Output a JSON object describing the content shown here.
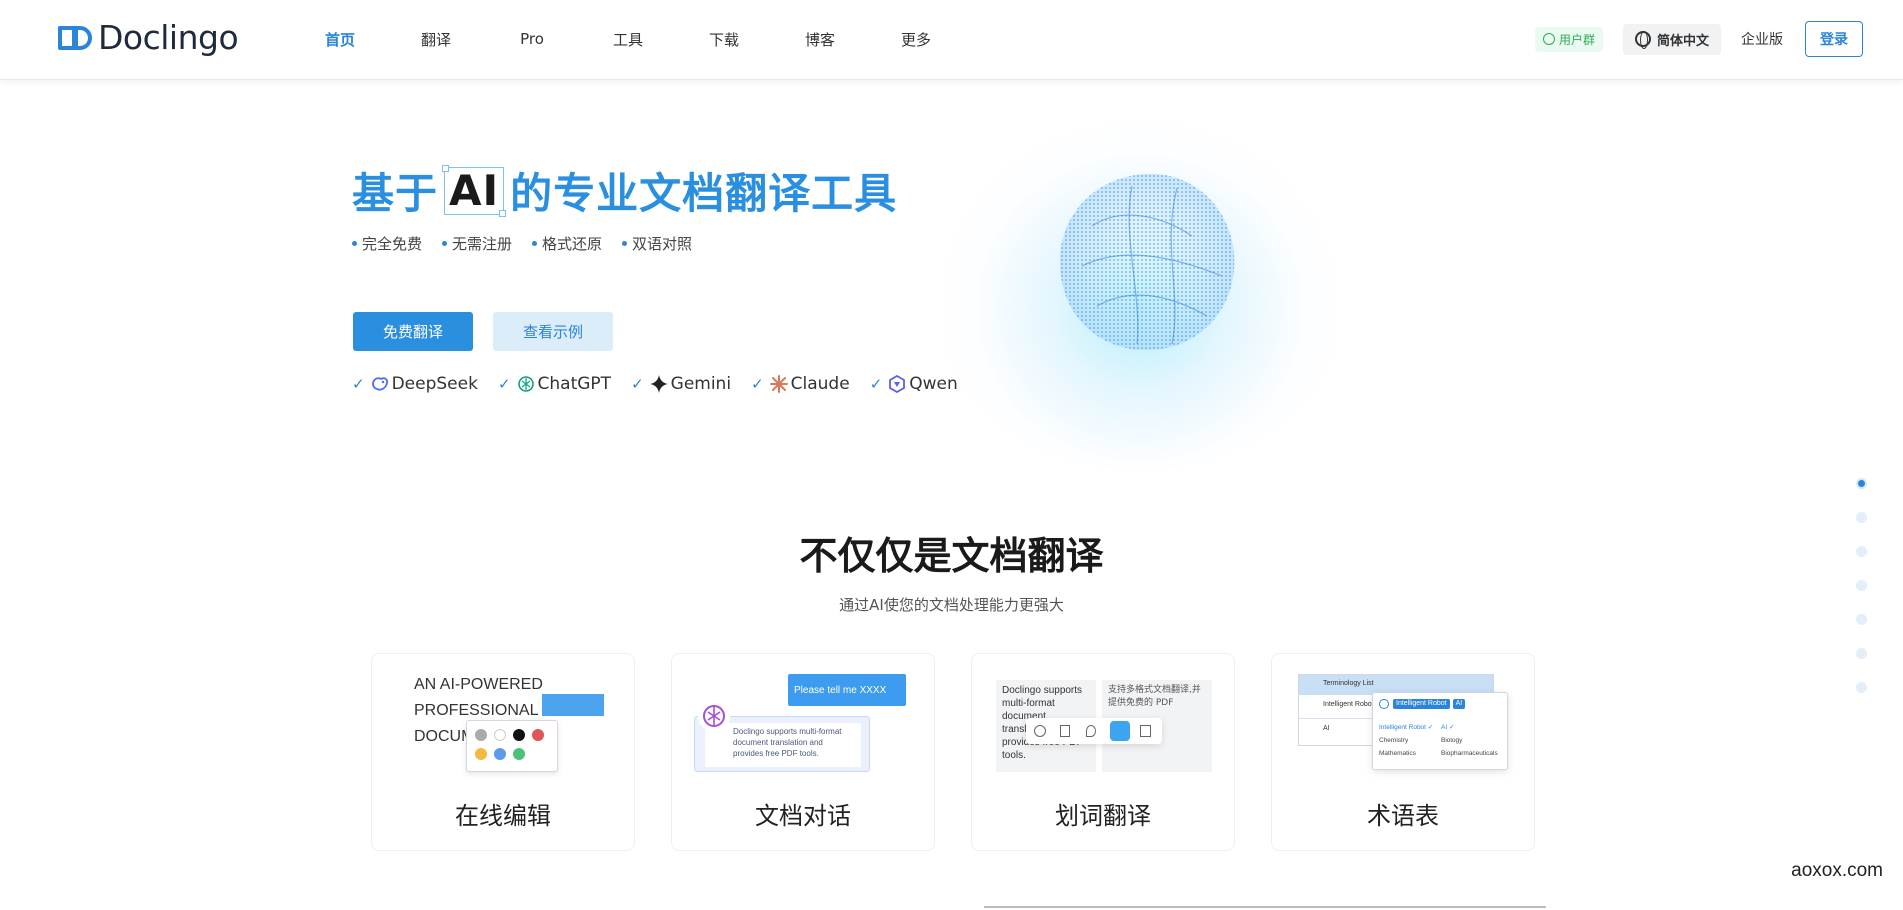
{
  "header": {
    "logo_text": "Doclingo",
    "nav": [
      {
        "label": "首页",
        "active": true
      },
      {
        "label": "翻译"
      },
      {
        "label": "Pro"
      },
      {
        "label": "工具"
      },
      {
        "label": "下载"
      },
      {
        "label": "博客"
      },
      {
        "label": "更多"
      }
    ],
    "user_group": "用户群",
    "language": "简体中文",
    "enterprise": "企业版",
    "login": "登录"
  },
  "hero": {
    "title_prefix": "基于",
    "title_ai": "AI",
    "title_suffix": "的专业文档翻译工具",
    "features": [
      "完全免费",
      "无需注册",
      "格式还原",
      "双语对照"
    ],
    "primary_button": "免费翻译",
    "secondary_button": "查看示例",
    "models": [
      "DeepSeek",
      "ChatGPT",
      "Gemini",
      "Claude",
      "Qwen"
    ]
  },
  "section": {
    "title": "不仅仅是文档翻译",
    "subtitle": "通过AI使您的文档处理能力更强大",
    "cards": [
      {
        "label": "在线编辑",
        "preview_text": "AN AI-POWERED PROFESSIONAL DOCUM"
      },
      {
        "label": "文档对话",
        "bubble": "Please tell me XXXX",
        "doc_text": "Doclingo supports multi-format document translation and provides free PDF tools."
      },
      {
        "label": "划词翻译",
        "left_text": "Doclingo supports multi-format document translation and provides free PDF tools.",
        "right_text": "支持多格式文档翻译,并提供免费的 PDF"
      },
      {
        "label": "术语表",
        "table_header": "Terminology List",
        "rows": [
          "Intelligent Robot",
          "AI"
        ],
        "tags": [
          "Intelligent Robot",
          "AI"
        ],
        "options": [
          [
            "Intelligent Robot ✓",
            "AI ✓"
          ],
          [
            "Chemistry",
            "Biology"
          ],
          [
            "Mathematics",
            "Biopharmaceuticals"
          ]
        ]
      }
    ]
  },
  "watermark": "aoxox.com",
  "colors": {
    "primary": "#2b84d8",
    "title_blue": "#2b8fdf",
    "green": "#2eaa5b"
  }
}
